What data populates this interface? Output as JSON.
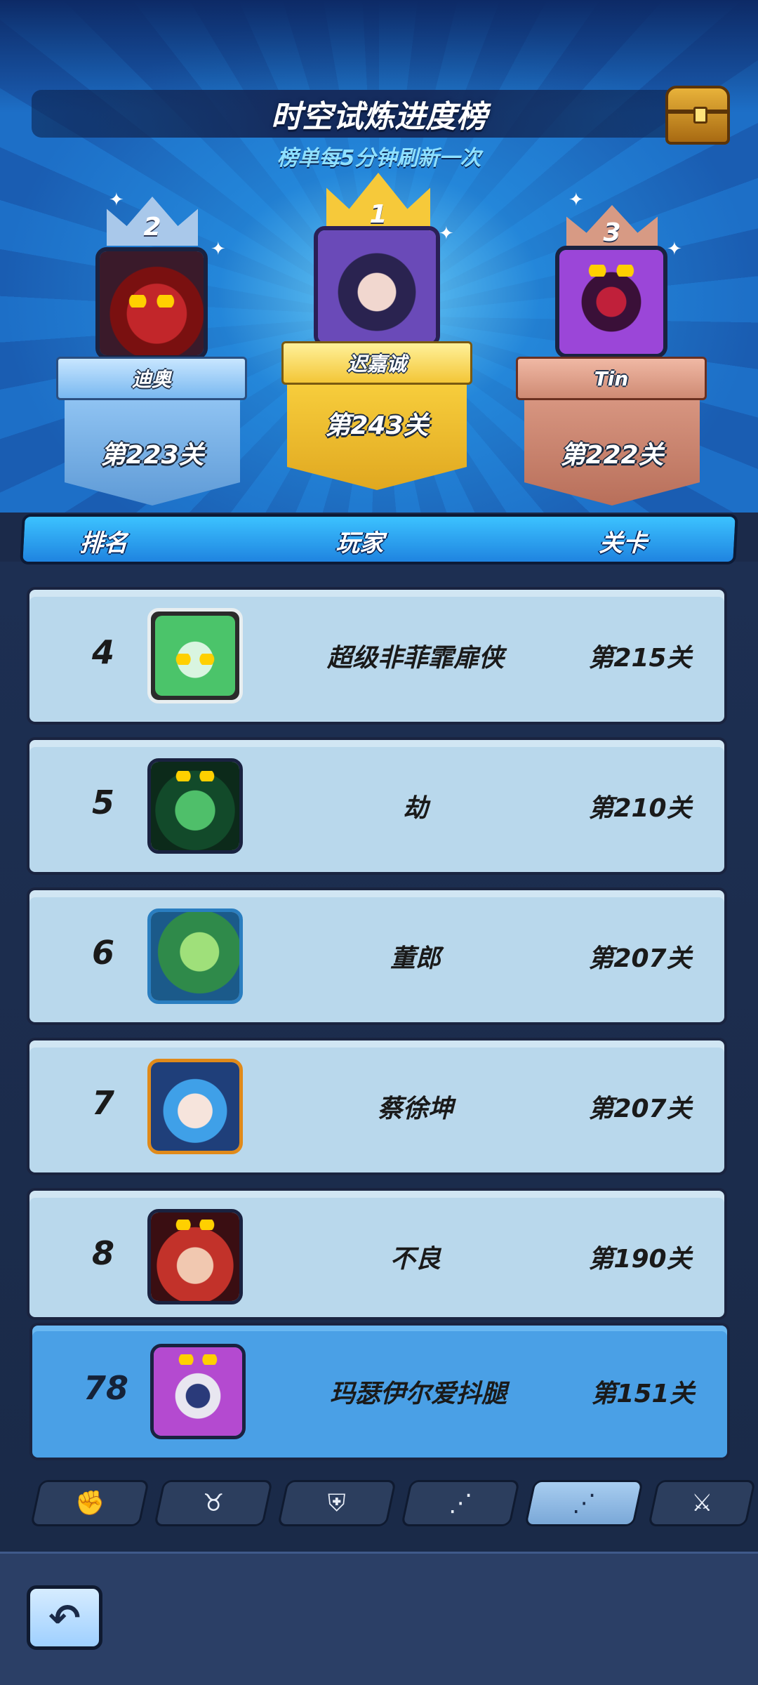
{
  "header": {
    "title": "时空试炼进度榜",
    "subtitle": "榜单每5分钟刷新一次"
  },
  "podium": [
    {
      "rank": "2",
      "name": "迪奥",
      "stage": "第223关",
      "color": "#8fc3f2"
    },
    {
      "rank": "1",
      "name": "迟嘉诚",
      "stage": "第243关",
      "color": "#f3c637"
    },
    {
      "rank": "3",
      "name": "Tin",
      "stage": "第222关",
      "color": "#d79580"
    }
  ],
  "columns": {
    "rank": "排名",
    "player": "玩家",
    "stage": "关卡"
  },
  "rows": [
    {
      "rank": "4",
      "name": "超级非菲霏扉侠",
      "stage": "第215关"
    },
    {
      "rank": "5",
      "name": "劫",
      "stage": "第210关"
    },
    {
      "rank": "6",
      "name": "董郎",
      "stage": "第207关"
    },
    {
      "rank": "7",
      "name": "蔡徐坤",
      "stage": "第207关"
    },
    {
      "rank": "8",
      "name": "不良",
      "stage": "第190关"
    }
  ],
  "me": {
    "rank": "78",
    "name": "玛瑟伊尔爱抖腿",
    "stage": "第151关"
  },
  "tabs": [
    {
      "icon": "fist-icon",
      "glyph": "✊"
    },
    {
      "icon": "bull-icon",
      "glyph": "♉"
    },
    {
      "icon": "shield-icon",
      "glyph": "⛨"
    },
    {
      "icon": "nodes-icon",
      "glyph": "⋰"
    },
    {
      "icon": "nodes-active-icon",
      "glyph": "⋰"
    },
    {
      "icon": "sword-icon",
      "glyph": "⚔"
    }
  ],
  "back_button": {
    "icon": "back-arrow-icon",
    "glyph": "↶"
  },
  "colors": {
    "accent": "#2fa6f5",
    "row_bg": "#b9d8ec",
    "me_row_bg": "#4aa0e6"
  }
}
